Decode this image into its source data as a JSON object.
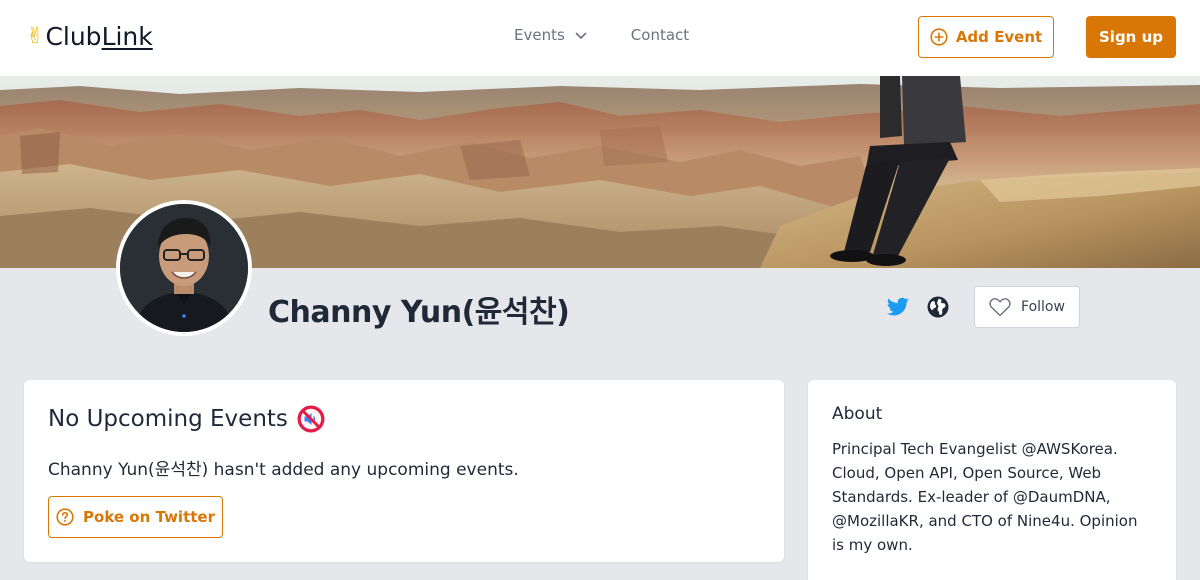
{
  "brand": {
    "name_club": "Club",
    "name_link": "Link",
    "accent_color": "#d97706"
  },
  "nav": {
    "events_label": "Events",
    "contact_label": "Contact"
  },
  "header_actions": {
    "add_event_label": "Add Event",
    "sign_up_label": "Sign up"
  },
  "profile": {
    "name": "Channy Yun(윤석찬)",
    "follow_label": "Follow"
  },
  "events_card": {
    "title": "No Upcoming Events",
    "message": "Channy Yun(윤석찬) hasn't added any upcoming events.",
    "poke_label": "Poke on Twitter"
  },
  "about_card": {
    "title": "About",
    "text": "Principal Tech Evangelist @AWSKorea. Cloud, Open API, Open Source, Web Standards. Ex-leader of @DaumDNA, @MozillaKR, and CTO of Nine4u. Opinion is my own."
  },
  "icons": {
    "logo": "victory-hand-icon",
    "events_dropdown": "chevron-down-icon",
    "add_event": "plus-circle-icon",
    "twitter": "twitter-icon",
    "website": "globe-icon",
    "follow": "heart-icon",
    "no_events": "muted-speaker-icon",
    "poke": "question-circle-icon"
  }
}
